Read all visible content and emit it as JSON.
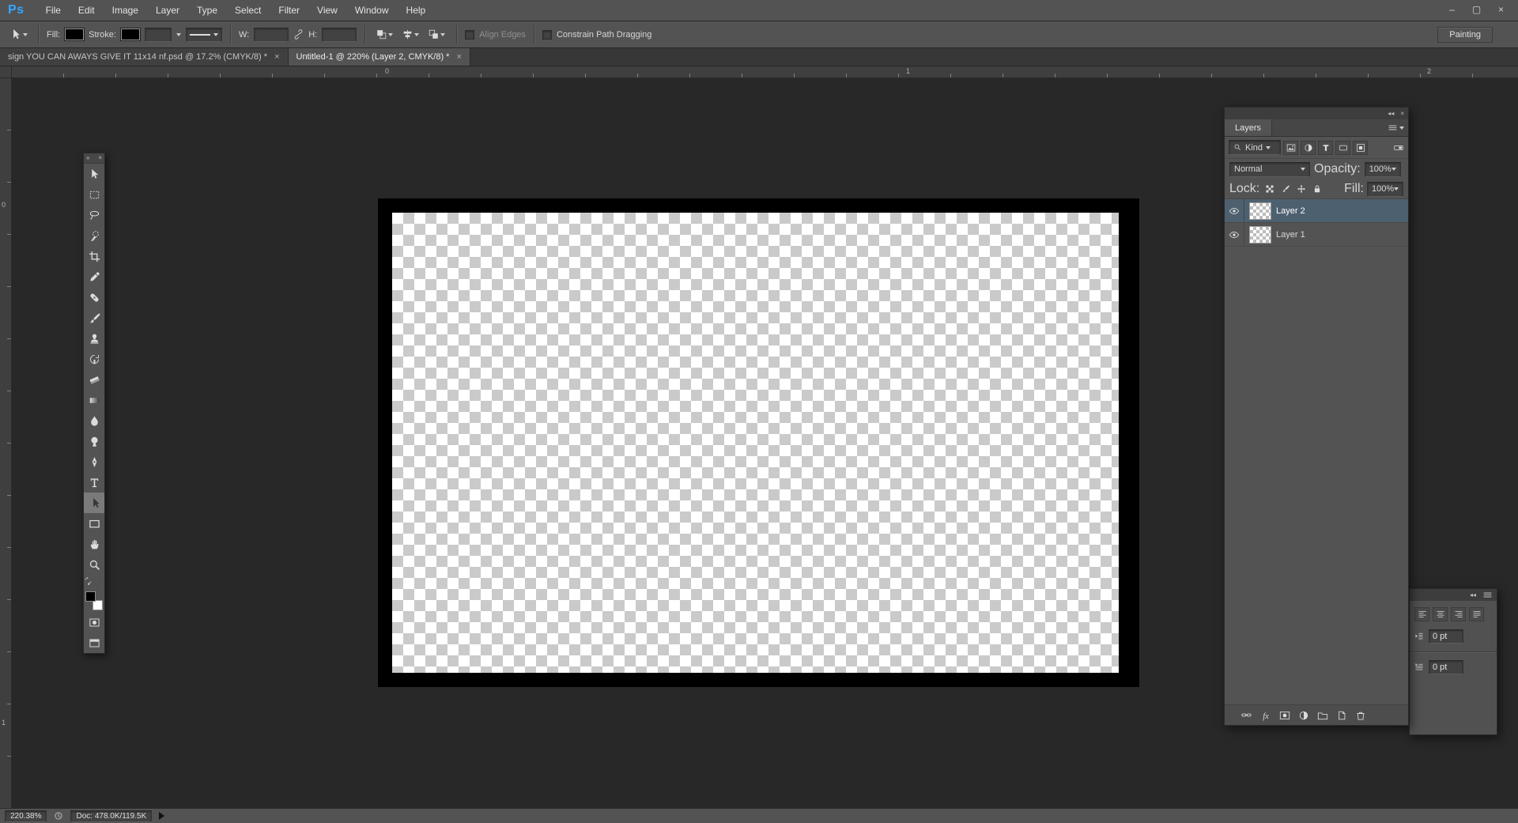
{
  "colors": {
    "accent_blue": "#31a8ff",
    "selected_layer": "#4d6070",
    "chrome": "#535353",
    "canvas_background": "#282828"
  },
  "menu_bar": {
    "logo": "Ps",
    "items": [
      "File",
      "Edit",
      "Image",
      "Layer",
      "Type",
      "Select",
      "Filter",
      "View",
      "Window",
      "Help"
    ],
    "window_controls": [
      {
        "name": "minimize-button",
        "glyph": "–"
      },
      {
        "name": "restore-button",
        "glyph": "▢"
      },
      {
        "name": "close-button",
        "glyph": "×"
      }
    ]
  },
  "options_bar": {
    "fill_label": "Fill:",
    "stroke_label": "Stroke:",
    "stroke_width_value": "",
    "w_label": "W:",
    "w_value": "",
    "h_label": "H:",
    "h_value": "",
    "path_buttons": [
      "path-operations-button",
      "path-alignment-button",
      "path-arrangement-button"
    ],
    "align_edges_label": "Align Edges",
    "constrain_label": "Constrain Path Dragging",
    "workspace_button": "Painting"
  },
  "document_tabs": [
    {
      "title": "sign YOU CAN AWAYS GIVE IT 11x14 nf.psd @ 17.2% (CMYK/8) *",
      "close": "×",
      "active": false
    },
    {
      "title": "Untitled-1 @ 220% (Layer 2, CMYK/8) *",
      "close": "×",
      "active": true
    }
  ],
  "rulers": {
    "horizontal_labels": [
      "0",
      "1",
      "2"
    ],
    "vertical_labels": [
      "0",
      "1"
    ]
  },
  "toolbar": {
    "collapse_glyph": "»",
    "close_glyph": "×",
    "tools": [
      {
        "name": "move-tool",
        "selected": false
      },
      {
        "name": "rectangular-marquee-tool",
        "selected": false
      },
      {
        "name": "lasso-tool",
        "selected": false
      },
      {
        "name": "quick-selection-tool",
        "selected": false
      },
      {
        "name": "crop-tool",
        "selected": false
      },
      {
        "name": "eyedropper-tool",
        "selected": false
      },
      {
        "name": "spot-healing-brush-tool",
        "selected": false
      },
      {
        "name": "brush-tool",
        "selected": false
      },
      {
        "name": "clone-stamp-tool",
        "selected": false
      },
      {
        "name": "history-brush-tool",
        "selected": false
      },
      {
        "name": "eraser-tool",
        "selected": false
      },
      {
        "name": "gradient-tool",
        "selected": false
      },
      {
        "name": "blur-tool",
        "selected": false
      },
      {
        "name": "dodge-tool",
        "selected": false
      },
      {
        "name": "pen-tool",
        "selected": false
      },
      {
        "name": "type-tool",
        "selected": false
      },
      {
        "name": "path-selection-tool",
        "selected": true
      },
      {
        "name": "rectangle-tool",
        "selected": false
      },
      {
        "name": "hand-tool",
        "selected": false
      },
      {
        "name": "zoom-tool",
        "selected": false
      }
    ]
  },
  "layers_panel": {
    "collapse_glyph": "◂◂",
    "close_glyph": "×",
    "tab_label": "Layers",
    "kind_label": "Kind",
    "filter_icons": [
      "pixel-filter-icon",
      "adjustment-filter-icon",
      "type-filter-icon",
      "shape-filter-icon",
      "smart-object-filter-icon"
    ],
    "blend_mode": "Normal",
    "opacity_label": "Opacity:",
    "opacity_value": "100%",
    "lock_label": "Lock:",
    "lock_icons": [
      "lock-transparency-icon",
      "lock-pixels-icon",
      "lock-position-icon",
      "lock-all-icon"
    ],
    "fill_label": "Fill:",
    "fill_value": "100%",
    "layers": [
      {
        "name": "Layer 2",
        "selected": true
      },
      {
        "name": "Layer 1",
        "selected": false
      }
    ],
    "bottom_icons": [
      "link-layers-icon",
      "layer-effects-icon",
      "layer-mask-icon",
      "adjustment-layer-icon",
      "layer-group-icon",
      "new-layer-icon",
      "delete-layer-icon"
    ]
  },
  "paragraph_panel": {
    "collapse_glyph": "◂◂",
    "align_icons": [
      "align-left-icon",
      "align-center-icon",
      "align-right-icon",
      "justify-last-left-icon"
    ],
    "fields": [
      {
        "value": "0 pt"
      },
      {
        "value": "0 pt"
      }
    ]
  },
  "status_bar": {
    "zoom": "220.38%",
    "doc_info": "Doc: 478.0K/119.5K"
  }
}
